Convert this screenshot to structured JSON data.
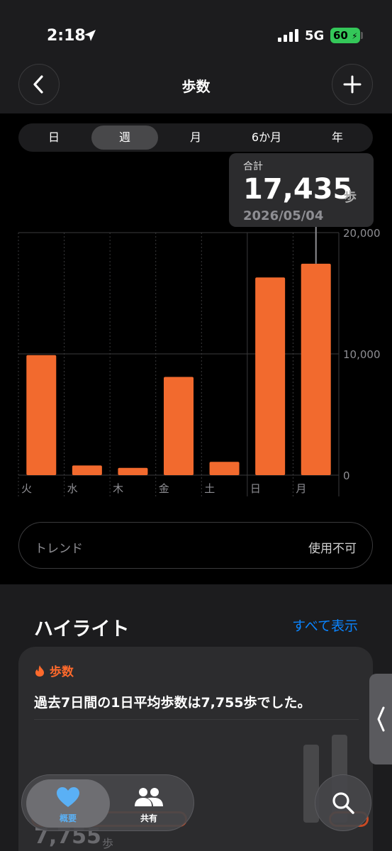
{
  "status_bar": {
    "time": "2:18",
    "network": "5G",
    "battery": "60"
  },
  "nav": {
    "title": "歩数"
  },
  "segments": [
    {
      "label": "日",
      "active": false
    },
    {
      "label": "週",
      "active": true
    },
    {
      "label": "月",
      "active": false
    },
    {
      "label": "6か月",
      "active": false
    },
    {
      "label": "年",
      "active": false
    }
  ],
  "selection": {
    "label": "合計",
    "value": "17,435",
    "unit": "歩",
    "date": "2026/05/04"
  },
  "chart_data": {
    "type": "bar",
    "categories": [
      "火",
      "水",
      "木",
      "金",
      "土",
      "日",
      "月"
    ],
    "values": [
      9900,
      800,
      600,
      8100,
      1100,
      16300,
      17435
    ],
    "ylim": [
      0,
      20000
    ],
    "y_ticks": [
      "0",
      "10,000",
      "20,000"
    ],
    "color": "#f26a2e",
    "grid": true,
    "selected_index": 6
  },
  "trend": {
    "label": "トレンド",
    "value": "使用不可"
  },
  "highlights": {
    "title": "ハイライト",
    "show_all": "すべて表示",
    "card": {
      "category": "歩数",
      "text": "過去7日間の1日平均歩数は7,755歩でした。",
      "value": "7,755",
      "unit": "歩"
    }
  },
  "tabbar": {
    "items": [
      {
        "label": "概要",
        "icon": "heart-icon",
        "active": true
      },
      {
        "label": "共有",
        "icon": "people-icon",
        "active": false
      }
    ],
    "search_icon": "search-icon"
  },
  "colors": {
    "accent": "#f26a2e",
    "link": "#0a84ff",
    "battery": "#34c759",
    "heart": "#5ab0f5"
  }
}
